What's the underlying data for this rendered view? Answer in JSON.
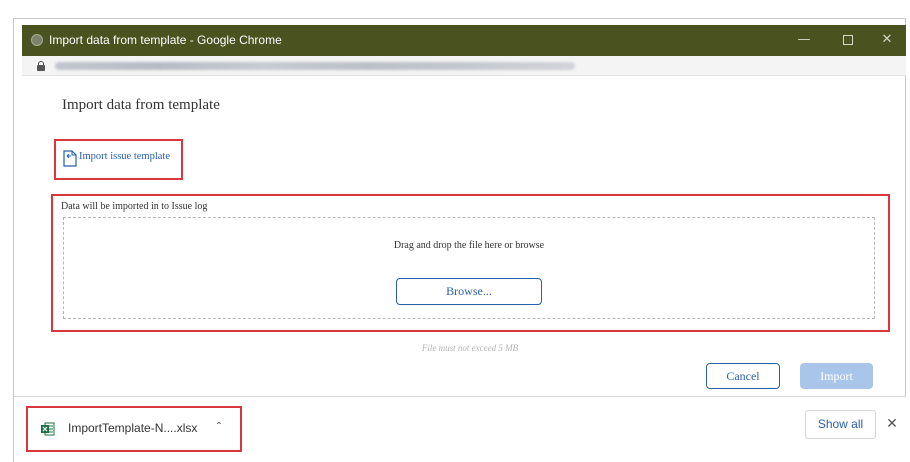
{
  "window": {
    "title": "Import data from template - Google Chrome",
    "minimize_icon": "minimize-icon",
    "maximize_icon": "maximize-icon",
    "close_icon": "close-icon",
    "close_glyph": "✕",
    "minimize_glyph": "—"
  },
  "address_bar": {
    "lock_icon": "lock-icon"
  },
  "dialog": {
    "title": "Import data from template",
    "import_template_link": "Import issue template",
    "dropzone_label": "Data will be imported in to Issue log",
    "dropzone_text": "Drag and drop the file here or browse",
    "browse_label": "Browse...",
    "size_note": "File must not exceed 5 MB",
    "cancel_label": "Cancel",
    "import_label": "Import"
  },
  "download_shelf": {
    "filename": "ImportTemplate-N....xlsx",
    "chevron_glyph": "⌃",
    "show_all_label": "Show all",
    "close_glyph": "✕"
  },
  "colors": {
    "titlebar": "#4a521f",
    "link_blue": "#2a5fa8",
    "highlight_red": "#d9363e",
    "import_disabled": "#a9c6ea",
    "excel_green": "#1d7044"
  }
}
